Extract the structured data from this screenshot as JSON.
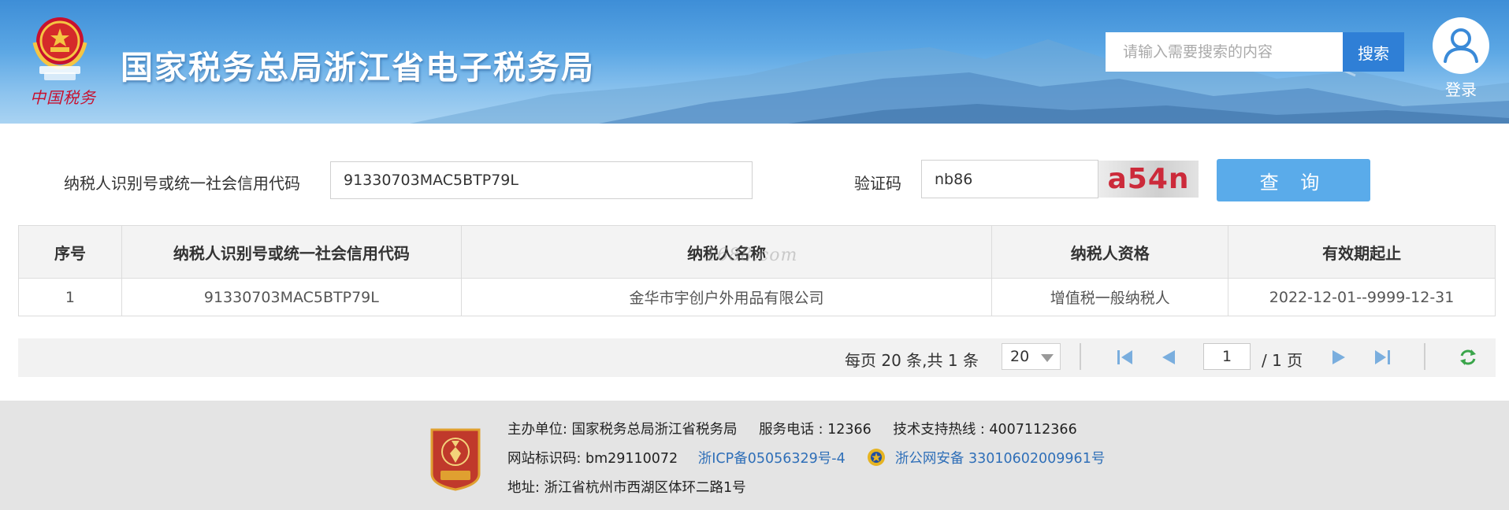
{
  "header": {
    "logo_script": "中国税务",
    "site_title": "国家税务总局浙江省电子税务局",
    "search": {
      "placeholder": "请输入需要搜索的内容",
      "button_label": "搜索"
    },
    "login_label": "登录"
  },
  "query_form": {
    "tax_id_label": "纳税人识别号或统一社会信用代码",
    "tax_id_value": "91330703MAC5BTP79L",
    "captcha_label": "验证码",
    "captcha_value": "nb86",
    "captcha_image_text": "a54n",
    "query_button_label": "查 询"
  },
  "results": {
    "columns": [
      "序号",
      "纳税人识别号或统一社会信用代码",
      "纳税人名称",
      "纳税人资格",
      "有效期起止"
    ],
    "rows": [
      [
        "1",
        "91330703MAC5BTP79L",
        "金华市宇创户外用品有限公司",
        "增值税一般纳税人",
        "2022-12-01--9999-12-31"
      ]
    ],
    "watermark": "1688.com"
  },
  "pager": {
    "info": "每页 20 条,共 1 条",
    "page_size": "20",
    "current_page": "1",
    "total_pages": "/ 1 页"
  },
  "footer": {
    "sponsor_label": "主办单位:",
    "sponsor": "国家税务总局浙江省税务局",
    "service_phone": "服务电话 : 12366",
    "support_hotline": "技术支持热线 : 4007112366",
    "site_id": "网站标识码:  bm29110072",
    "icp": "浙ICP备05056329号-4",
    "police_record": "浙公网安备 33010602009961号",
    "address": "地址:  浙江省杭州市西湖区体环二路1号"
  },
  "colors": {
    "header_blue": "#3e8ed7",
    "search_button": "#2f7fd6",
    "query_button": "#5aabea",
    "captcha_text": "#cc2a3a",
    "footer_link": "#2f6fb8",
    "footer_bg": "#e4e4e4"
  },
  "icons": [
    "national-emblem-icon",
    "user-avatar-icon",
    "first-page-icon",
    "prev-page-icon",
    "next-page-icon",
    "last-page-icon",
    "refresh-icon",
    "police-badge-icon",
    "tax-emblem-icon"
  ]
}
